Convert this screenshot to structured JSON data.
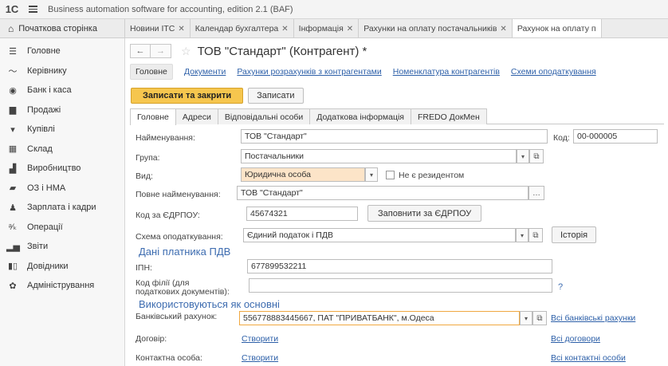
{
  "app": {
    "logo": "1С",
    "title": "Business automation software for accounting, edition 2.1  (BAF)"
  },
  "tabs": {
    "home": "Початкова сторінка",
    "items": [
      {
        "label": "Новини ІТС"
      },
      {
        "label": "Календар бухгалтера"
      },
      {
        "label": "Інформація"
      },
      {
        "label": "Рахунки на оплату постачальників"
      },
      {
        "label": "Рахунок на оплату п"
      }
    ]
  },
  "sidebar": {
    "items": [
      {
        "label": "Головне",
        "icon": "menu-icon"
      },
      {
        "label": "Керівнику",
        "icon": "chart-line-icon"
      },
      {
        "label": "Банк і каса",
        "icon": "bank-icon"
      },
      {
        "label": "Продажі",
        "icon": "bag-icon"
      },
      {
        "label": "Купівлі",
        "icon": "cart-icon"
      },
      {
        "label": "Склад",
        "icon": "warehouse-icon"
      },
      {
        "label": "Виробництво",
        "icon": "factory-icon"
      },
      {
        "label": "ОЗ і НМА",
        "icon": "truck-icon"
      },
      {
        "label": "Зарплата і кадри",
        "icon": "person-icon"
      },
      {
        "label": "Операції",
        "icon": "operations-icon"
      },
      {
        "label": "Звіти",
        "icon": "report-bars-icon"
      },
      {
        "label": "Довідники",
        "icon": "books-icon"
      },
      {
        "label": "Адміністрування",
        "icon": "gear-icon"
      }
    ]
  },
  "form": {
    "title": "ТОВ \"Стандарт\" (Контрагент) *",
    "section_links": [
      "Головне",
      "Документи",
      "Рахунки розрахунків з контрагентами",
      "Номенклатура контрагентів",
      "Схеми оподаткування"
    ],
    "save_close": "Записати та закрити",
    "save": "Записати",
    "tabs": [
      "Головне",
      "Адреси",
      "Відповідальні особи",
      "Додаткова інформація",
      "FREDO ДокМен"
    ]
  },
  "fields": {
    "name_label": "Найменування:",
    "name_value": "ТОВ \"Стандарт\"",
    "code_label": "Код:",
    "code_value": "00-000005",
    "group_label": "Група:",
    "group_value": "Постачальники",
    "kind_label": "Вид:",
    "kind_value": "Юридична особа",
    "nonresident_label": "Не є резидентом",
    "fullname_label": "Повне найменування:",
    "fullname_value": "ТОВ \"Стандарт\"",
    "edrpou_label": "Код за ЄДРПОУ:",
    "edrpou_value": "45674321",
    "fill_edrpou": "Заповнити за ЄДРПОУ",
    "tax_label": "Схема оподаткування:",
    "tax_value": "Єдиний податок і ПДВ",
    "history": "Історія",
    "vat_group": "Дані платника ПДВ",
    "ipn_label": "ІПН:",
    "ipn_value": "677899532211",
    "branch_label_1": "Код філії (для",
    "branch_label_2": "податкових документів):",
    "branch_help": "?",
    "main_group": "Використовуються як основні",
    "bank_label": "Банківський рахунок:",
    "bank_value": "556778883445667, ПАТ \"ПРИВАТБАНК\", м.Одеса",
    "bank_all": "Всі банківські рахунки",
    "contract_label": "Договір:",
    "contract_create": "Створити",
    "contract_all": "Всі договори",
    "contact_label": "Контактна особа:",
    "contact_create": "Створити",
    "contact_all": "Всі контактні особи"
  }
}
